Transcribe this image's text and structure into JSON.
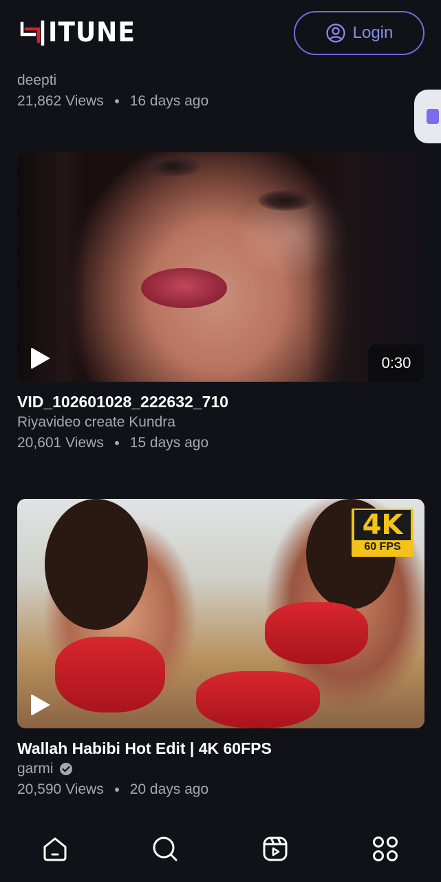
{
  "header": {
    "logo_text": "ITUNE",
    "login_label": "Login"
  },
  "feed": {
    "top_partial": {
      "channel": "deepti",
      "views": "21,862 Views",
      "age": "16 days ago"
    },
    "videos": [
      {
        "title": "VID_102601028_222632_710",
        "channel": "Riyavideo create Kundra",
        "views": "20,601 Views",
        "age": "15 days ago",
        "duration": "0:30",
        "verified": false
      },
      {
        "title": "Wallah Habibi Hot Edit | 4K 60FPS",
        "channel": "garmi",
        "views": "20,590 Views",
        "age": "20 days ago",
        "verified": true,
        "thumbnail_badge": {
          "main": "4K",
          "sub": "60 FPS"
        }
      }
    ]
  },
  "bottom_nav": {
    "items": [
      {
        "icon": "home-icon"
      },
      {
        "icon": "search-icon"
      },
      {
        "icon": "reels-icon"
      },
      {
        "icon": "apps-grid-icon"
      }
    ]
  },
  "colors": {
    "background": "#101217",
    "accent": "#6f6fe0",
    "meta_text": "#a6a8ae",
    "logo_red": "#e11d2b",
    "badge_yellow": "#f3c31a"
  }
}
